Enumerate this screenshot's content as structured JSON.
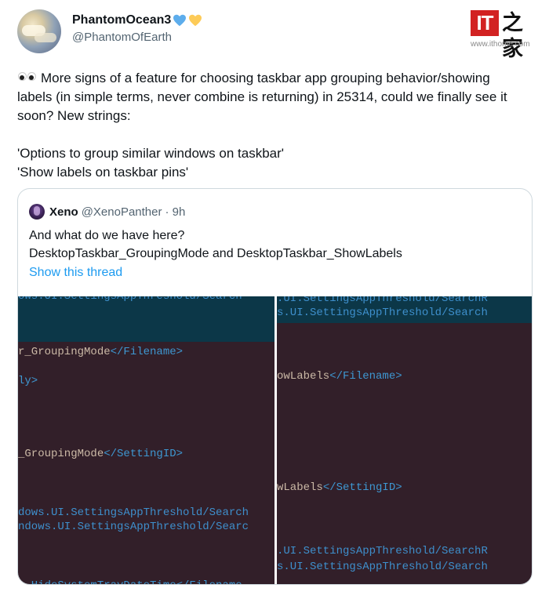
{
  "author": {
    "display_name": "PhantomOcean3",
    "handle": "@PhantomOfEarth",
    "emoji_names": [
      "blue-heart",
      "yellow-heart"
    ]
  },
  "watermark": {
    "brand_text": "IT之家",
    "url": "www.ithome.com"
  },
  "tweet": {
    "text": "More signs of a feature for choosing taskbar app grouping behavior/showing labels (in simple terms, never combine is returning) in 25314, could we finally see it soon? New strings:\n\n'Options to group similar windows on taskbar'\n'Show labels on taskbar pins'",
    "emoji_prefix": "eyes"
  },
  "quoted": {
    "name": "Xeno",
    "handle": "@XenoPanther",
    "time": "· 9h",
    "text": "And what do we have here?\nDesktopTaskbar_GroupingMode and DesktopTaskbar_ShowLabels",
    "show_thread": "Show this thread"
  },
  "code_images": {
    "left": {
      "top_cut": "ows.UI.SettingsAppThreshold/Search",
      "grouping_filename_text": "r_GroupingMode",
      "grouping_filename_tag": "</Filename>",
      "ly_text": "ly>",
      "settingid_text": "_GroupingMode",
      "settingid_tag": "</SettingID>",
      "path_line1": "dows.UI.SettingsAppThreshold/Search",
      "path_line2": "ndows.UI.SettingsAppThreshold/Searc",
      "bottom_cut": "  HideSystemTrayDateTime</Filename"
    },
    "right": {
      "top_line1": ".UI.SettingsAppThreshold/SearchR",
      "top_line2": "s.UI.SettingsAppThreshold/Search",
      "labels_filename_text": "owLabels",
      "labels_filename_tag": "</Filename>",
      "labels_settingid_text": "wLabels",
      "labels_settingid_tag": "</SettingID>",
      "bottom_line1": ".UI.SettingsAppThreshold/SearchR",
      "bottom_line2": "s.UI.SettingsAppThreshold/Search"
    }
  },
  "colors": {
    "link": "#1d9bf0",
    "code_bg": "#321f29",
    "code_teal": "#0c3748",
    "watermark_red": "#d22222"
  }
}
